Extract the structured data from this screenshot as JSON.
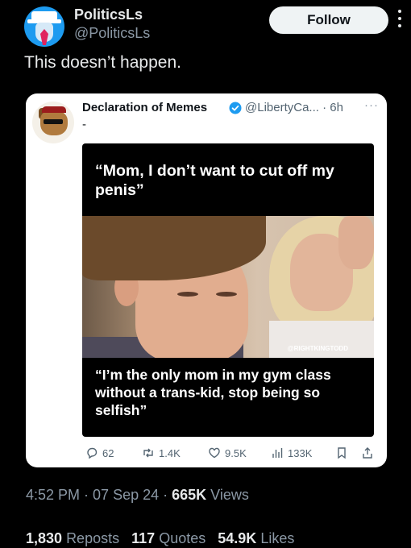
{
  "author": {
    "name": "PoliticsLs",
    "handle": "@PoliticsLs",
    "avatar_icon": "politicsls-avatar-icon"
  },
  "follow_label": "Follow",
  "tweet_text": "This doesn’t happen.",
  "quoted": {
    "name": "Declaration of Memes",
    "verified_icon": "verified-badge-icon",
    "handle_time": "@LibertyCa... · 6h",
    "more": "···",
    "text": "-",
    "meme": {
      "top_caption": "“Mom, I don’t want to cut off my penis”",
      "watermark": "@RIGHTKINGTODD",
      "bottom_caption": "“I’m the only mom in my gym class without a trans-kid, stop being so selfish”"
    },
    "actions": {
      "replies": "62",
      "reposts": "1.4K",
      "likes": "9.5K",
      "views": "133K"
    }
  },
  "meta": {
    "time": "4:52 PM",
    "date": "07 Sep 24",
    "views_count": "665K",
    "views_label": "Views"
  },
  "stats": {
    "reposts_count": "1,830",
    "reposts_label": "Reposts",
    "quotes_count": "117",
    "quotes_label": "Quotes",
    "likes_count": "54.9K",
    "likes_label": "Likes"
  },
  "colors": {
    "background": "#000000",
    "accent": "#1d9bf0",
    "muted": "#8b98a5"
  }
}
